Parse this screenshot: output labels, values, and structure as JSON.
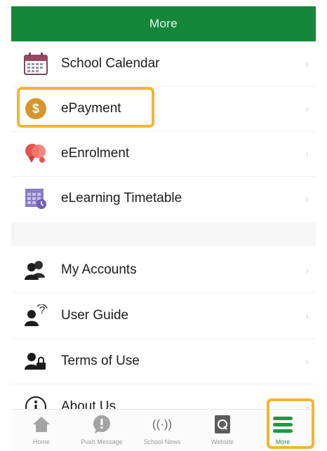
{
  "header": {
    "title": "More"
  },
  "menu": {
    "items": [
      {
        "label": "School Calendar",
        "icon": "calendar-icon"
      },
      {
        "label": "ePayment",
        "icon": "dollar-coin-icon"
      },
      {
        "label": "eEnrolment",
        "icon": "enrolment-icon"
      },
      {
        "label": "eLearning Timetable",
        "icon": "timetable-icon"
      },
      {
        "label": "My Accounts",
        "icon": "accounts-icon"
      },
      {
        "label": "User Guide",
        "icon": "user-guide-icon"
      },
      {
        "label": "Terms of Use",
        "icon": "terms-lock-icon"
      },
      {
        "label": "About Us",
        "icon": "info-icon"
      }
    ],
    "chevron": "›"
  },
  "tabbar": {
    "tabs": [
      {
        "label": "Home",
        "icon": "home-icon"
      },
      {
        "label": "Push Message",
        "icon": "message-icon"
      },
      {
        "label": "School News",
        "icon": "broadcast-icon"
      },
      {
        "label": "Website",
        "icon": "website-icon"
      },
      {
        "label": "More",
        "icon": "menu-icon"
      }
    ],
    "broadcast_glyph": "((·))"
  },
  "colors": {
    "header_green": "#15873a",
    "highlight_orange": "#f5b430",
    "active_green": "#1a9a3e"
  }
}
